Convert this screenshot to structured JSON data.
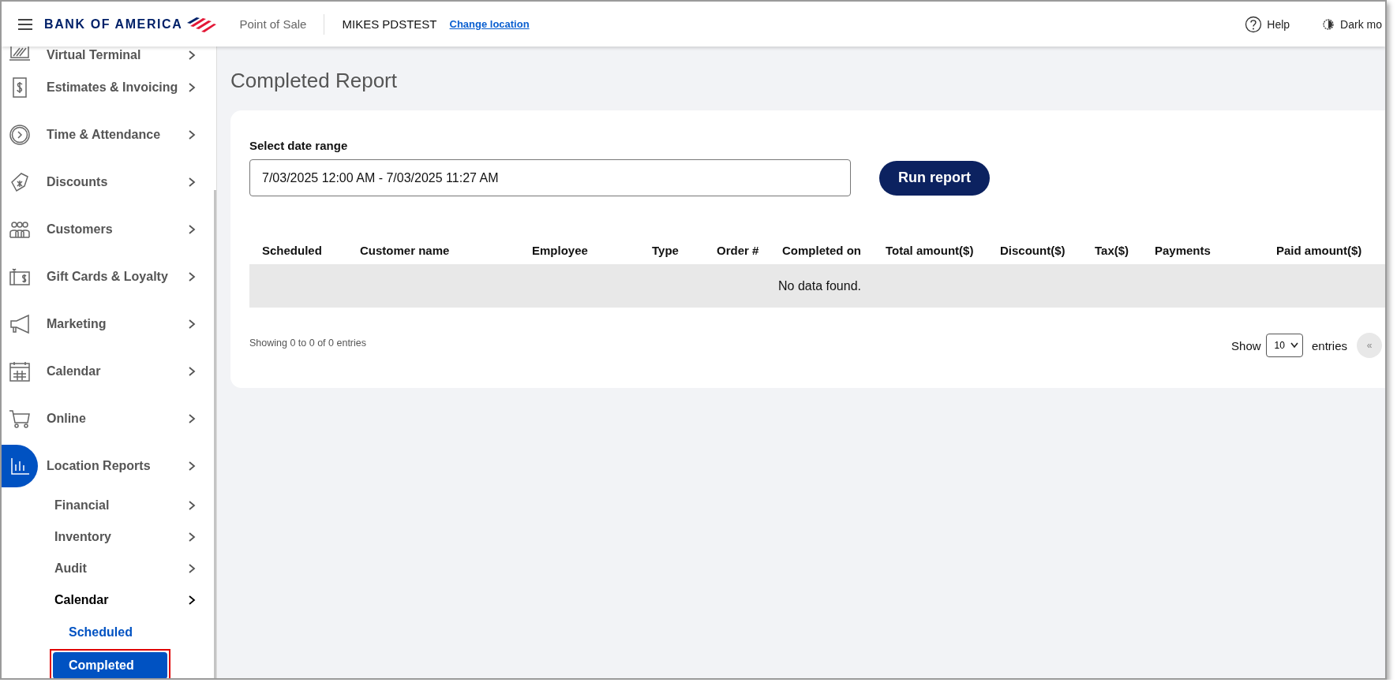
{
  "header": {
    "brand": "BANK OF AMERICA",
    "app_name": "Point of Sale",
    "location": "MIKES PDSTEST",
    "change_location": "Change location",
    "help": "Help",
    "dark_mode": "Dark mo"
  },
  "sidebar": {
    "items": [
      {
        "label": "Virtual Terminal",
        "active": false
      },
      {
        "label": "Estimates & Invoicing",
        "active": false
      },
      {
        "label": "Time & Attendance",
        "active": false
      },
      {
        "label": "Discounts",
        "active": false
      },
      {
        "label": "Customers",
        "active": false
      },
      {
        "label": "Gift Cards & Loyalty",
        "active": false
      },
      {
        "label": "Marketing",
        "active": false
      },
      {
        "label": "Calendar",
        "active": false
      },
      {
        "label": "Online",
        "active": false
      },
      {
        "label": "Location Reports",
        "active": true,
        "expanded": true,
        "children": [
          {
            "label": "Financial",
            "expanded": false
          },
          {
            "label": "Inventory",
            "expanded": false
          },
          {
            "label": "Audit",
            "expanded": false
          },
          {
            "label": "Calendar",
            "expanded": true,
            "children": [
              {
                "label": "Scheduled",
                "selected": false,
                "highlighted": false
              },
              {
                "label": "Completed",
                "selected": true,
                "highlighted": true
              }
            ]
          }
        ]
      }
    ]
  },
  "page": {
    "title": "Completed Report",
    "date_range": {
      "label": "Select date range",
      "value": "7/03/2025 12:00 AM - 7/03/2025 11:27 AM"
    },
    "run_button": "Run report",
    "table": {
      "columns": [
        "Scheduled",
        "Customer name",
        "Employee",
        "Type",
        "Order #",
        "Completed on",
        "Total amount($)",
        "Discount($)",
        "Tax($)",
        "Payments",
        "Paid amount($)"
      ],
      "empty_message": "No data found."
    },
    "footer": {
      "info": "Showing 0 to 0 of 0 entries",
      "show": "Show",
      "page_size": "10",
      "entries": "entries",
      "first_page": "«"
    }
  }
}
